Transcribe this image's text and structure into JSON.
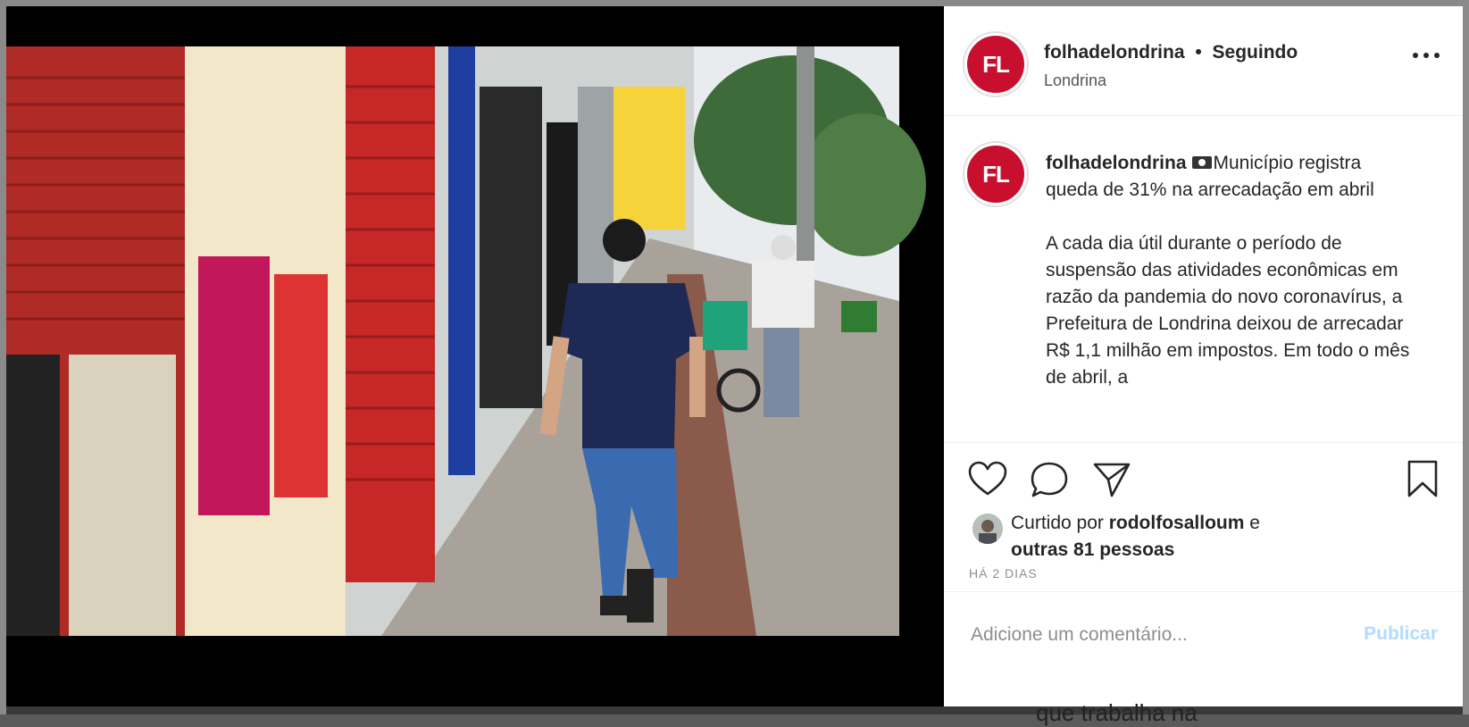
{
  "post": {
    "username": "folhadelondrina",
    "separator": "•",
    "follow_status": "Seguindo",
    "location": "Londrina",
    "avatar_initials": "FL",
    "caption_title": "Município registra queda de 31% na arrecadação em abril",
    "caption_body": "A cada dia útil durante o período de suspensão das atividades econômicas em razão da pandemia do novo coronavírus, a Prefeitura de Londrina deixou de arrecadar R$ 1,1 milhão em impostos. Em todo o mês de abril, a",
    "liked_by_prefix": "Curtido por",
    "liked_by_user": "rodolfosalloum",
    "liked_by_conj": "e",
    "liked_by_others": "outras 81 pessoas",
    "timestamp": "HÁ 2 DIAS"
  },
  "comment": {
    "placeholder": "Adicione um comentário...",
    "publish_label": "Publicar"
  },
  "background_text": "que trabalha na",
  "colors": {
    "brand_red": "#c8102e",
    "publish_disabled": "#b3dbff"
  },
  "icons": [
    "more-options-icon",
    "heart-icon",
    "comment-icon",
    "share-icon",
    "bookmark-icon",
    "camera-emoji-icon"
  ]
}
